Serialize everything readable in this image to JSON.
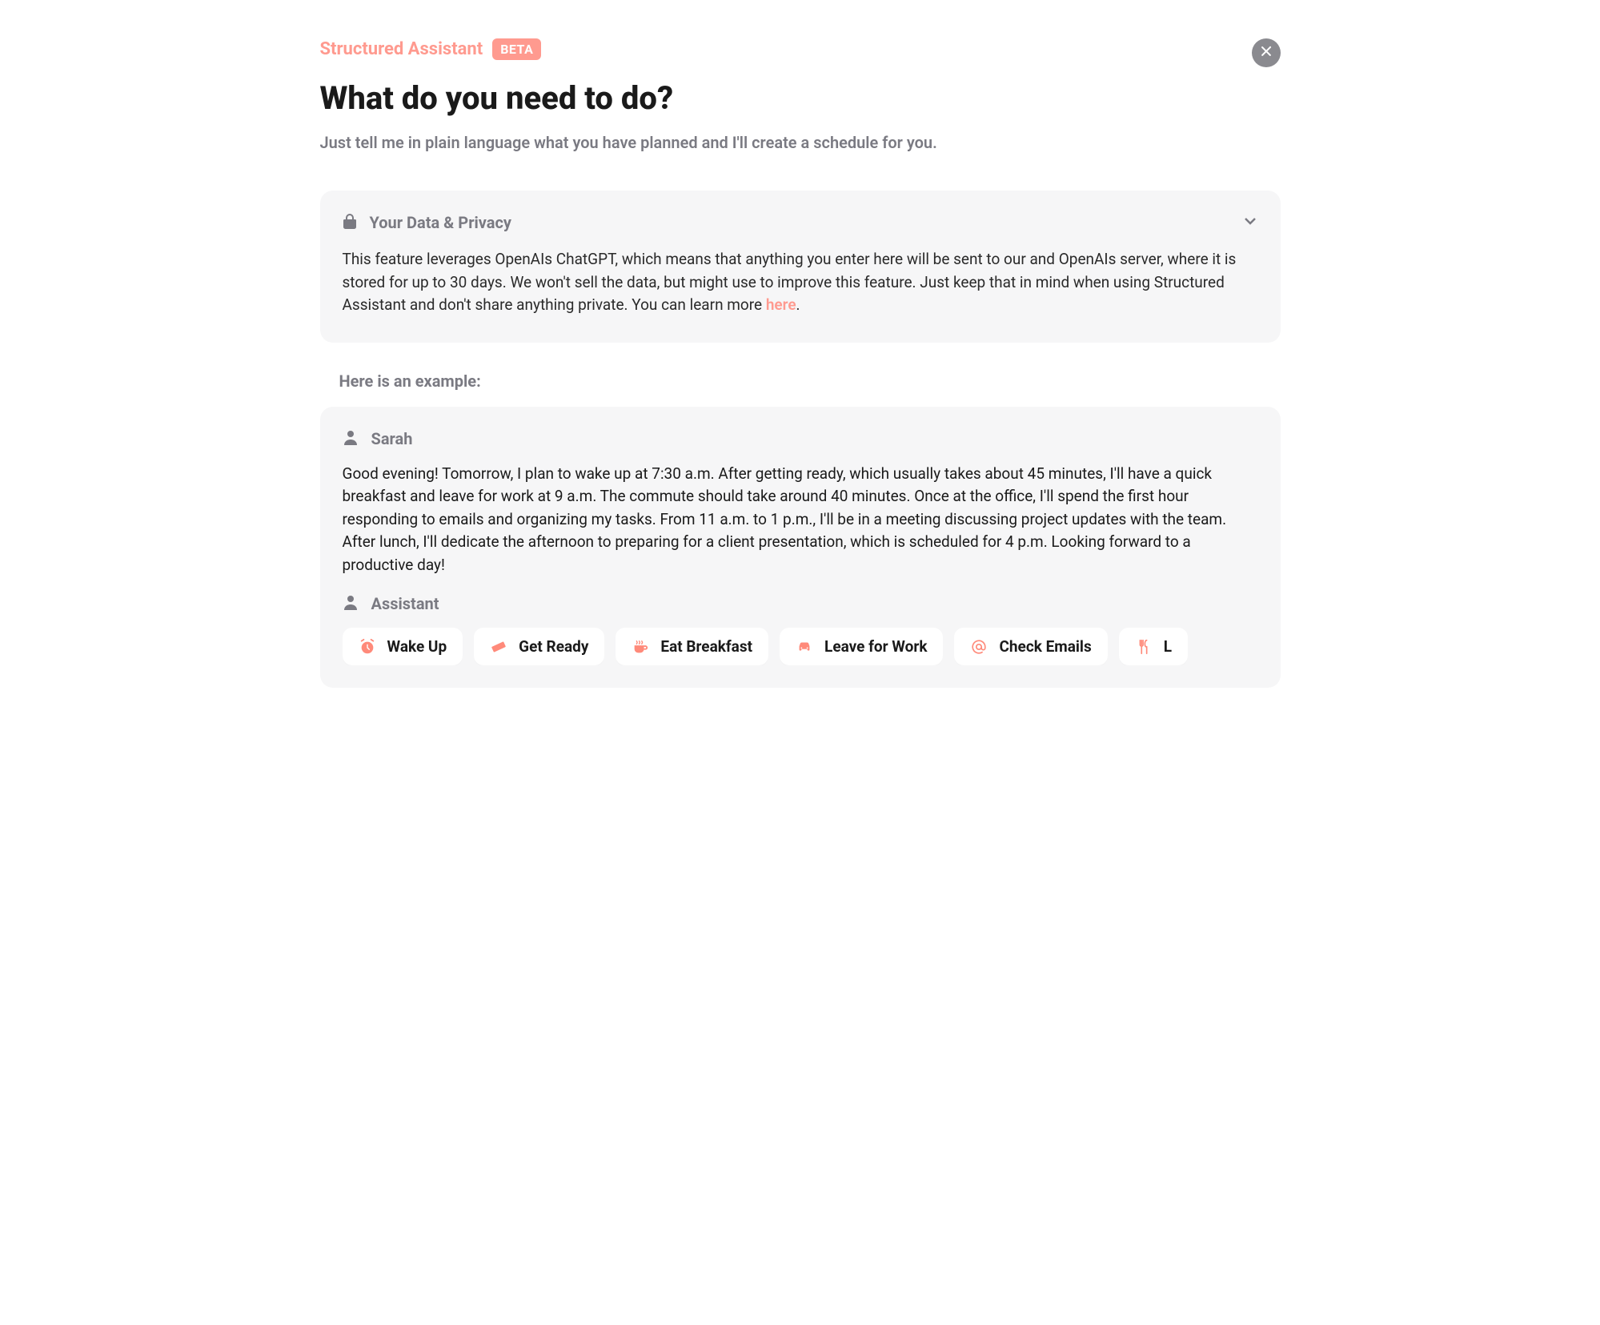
{
  "header": {
    "brand": "Structured Assistant",
    "badge": "BETA",
    "title": "What do you need to do?",
    "subtitle": "Just tell me in plain language what you have planned and I'll create a schedule for you."
  },
  "privacy": {
    "title": "Your Data & Privacy",
    "body_before_link": "This feature leverages OpenAIs ChatGPT, which means that anything you enter here will be sent to our and OpenAIs server, where it is stored for up to 30 days. We won't sell the data, but might use to improve this feature. Just keep that in mind when using Structured Assistant and don't share anything private. You can learn more ",
    "link_text": "here",
    "body_after_link": "."
  },
  "example": {
    "label": "Here is an example:",
    "user_name": "Sarah",
    "user_message": "Good evening! Tomorrow, I plan to wake up at 7:30 a.m. After getting ready, which usually takes about 45 minutes, I'll have a quick breakfast and leave for work at 9 a.m. The commute should take around 40 minutes. Once at the office, I'll spend the first hour responding to emails and organizing my tasks. From 11 a.m. to 1 p.m., I'll be in a meeting discussing project updates with the team. After lunch, I'll dedicate the afternoon to preparing for a client presentation, which is scheduled for 4 p.m. Looking forward to a productive day!",
    "assistant_name": "Assistant",
    "chips": [
      {
        "icon": "alarm-clock-icon",
        "label": "Wake Up"
      },
      {
        "icon": "ruler-icon",
        "label": "Get Ready"
      },
      {
        "icon": "coffee-icon",
        "label": "Eat Breakfast"
      },
      {
        "icon": "car-icon",
        "label": "Leave for Work"
      },
      {
        "icon": "at-sign-icon",
        "label": "Check Emails"
      },
      {
        "icon": "utensils-icon",
        "label": "L"
      }
    ]
  },
  "colors": {
    "accent": "#ff9a8f",
    "muted": "#7a7a82",
    "card_bg": "#f6f6f7"
  }
}
